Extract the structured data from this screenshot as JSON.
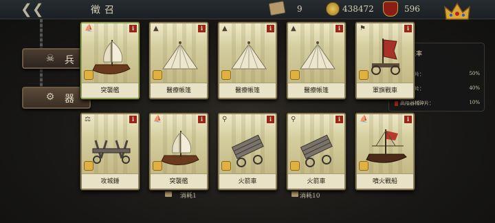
{
  "header": {
    "title": "徵召",
    "scroll_count": "9",
    "coin_count": "438472",
    "mask_count": "596"
  },
  "tabs": [
    {
      "label": "兵",
      "icon": "helmet-icon"
    },
    {
      "label": "器",
      "icon": "cannon-icon"
    }
  ],
  "probability_panel": {
    "title": "獲取概率",
    "rows": [
      {
        "label": "器械碎片：",
        "value": "50%",
        "color": "#8a8a8a"
      },
      {
        "label": "器械碎片：",
        "value": "40%",
        "color": "#3a6aa8"
      },
      {
        "label": "高階器械碎片：",
        "value": "10%",
        "color": "#9a2416"
      }
    ]
  },
  "cards": [
    {
      "name": "突襲艦",
      "type_icon": "ship-type-icon",
      "art": "warship"
    },
    {
      "name": "醫療帳篷",
      "type_icon": "tent-type-icon",
      "art": "tent"
    },
    {
      "name": "醫療帳篷",
      "type_icon": "tent-type-icon",
      "art": "tent"
    },
    {
      "name": "醫療帳篷",
      "type_icon": "tent-type-icon",
      "art": "tent"
    },
    {
      "name": "軍旗戰車",
      "type_icon": "flag-type-icon",
      "art": "flag-cart"
    },
    {
      "name": "攻城錘",
      "type_icon": "ram-type-icon",
      "art": "ram"
    },
    {
      "name": "突襲艦",
      "type_icon": "ship-type-icon",
      "art": "warship"
    },
    {
      "name": "火箭車",
      "type_icon": "rocket-type-icon",
      "art": "rocket-cart"
    },
    {
      "name": "火箭車",
      "type_icon": "rocket-type-icon",
      "art": "rocket-cart"
    },
    {
      "name": "噴火戰船",
      "type_icon": "fireship-type-icon",
      "art": "fire-ship"
    }
  ],
  "card_info_label": "i",
  "costs": [
    {
      "label": "消耗1"
    },
    {
      "label": "消耗10"
    }
  ]
}
